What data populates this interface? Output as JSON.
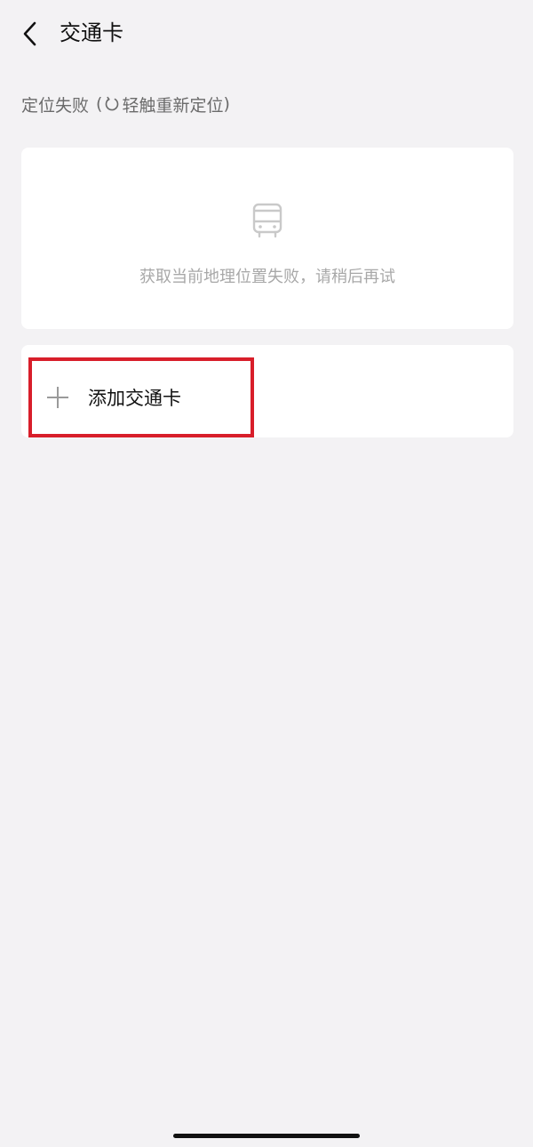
{
  "header": {
    "title": "交通卡",
    "back_icon": "chevron-left-icon"
  },
  "location": {
    "status_text": "定位失败",
    "paren_open": "(",
    "retry_icon": "refresh-icon",
    "retry_text": "轻触重新定位",
    "paren_close": ")"
  },
  "status_card": {
    "icon": "bus-icon",
    "message": "获取当前地理位置失败，请稍后再试"
  },
  "add_card": {
    "icon": "plus-icon",
    "label": "添加交通卡",
    "highlight_color": "#d81e2a"
  }
}
